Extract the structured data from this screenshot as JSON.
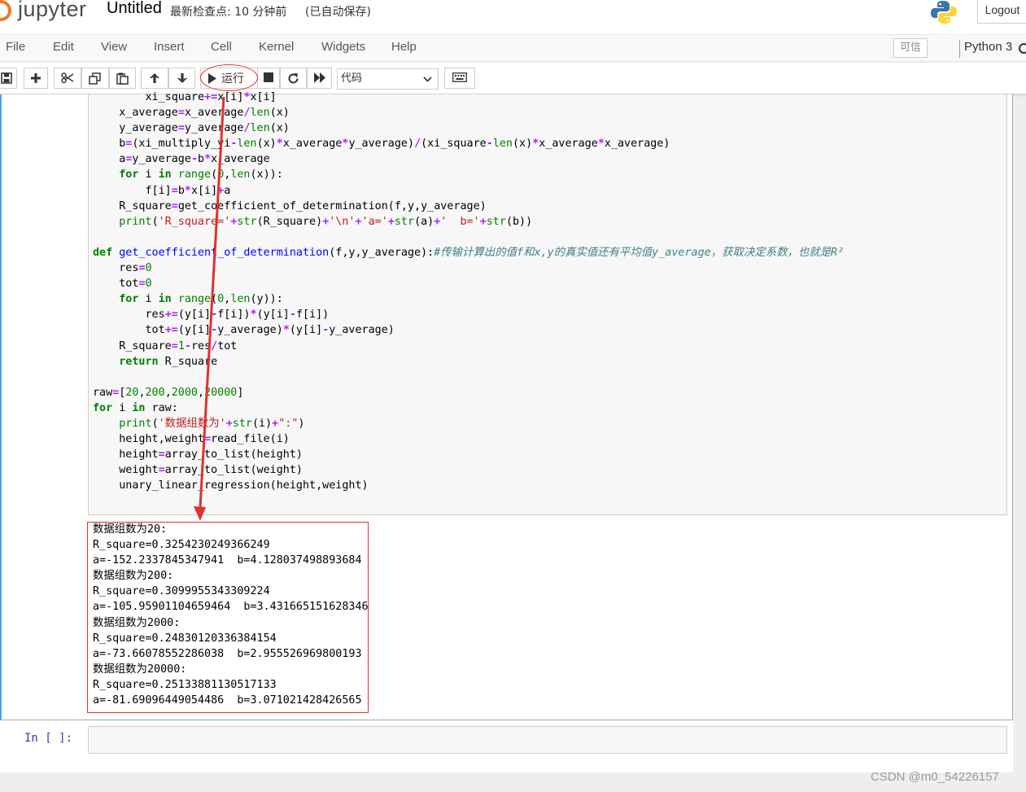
{
  "header": {
    "logo_text": "jupyter",
    "notebook_title": "Untitled",
    "checkpoint": "最新检查点: 10 分钟前",
    "autosave": "(已自动保存)",
    "logout_label": "Logout"
  },
  "menubar": {
    "items": [
      "File",
      "Edit",
      "View",
      "Insert",
      "Cell",
      "Kernel",
      "Widgets",
      "Help"
    ],
    "trusted_label": "可信",
    "kernel_name": "Python 3"
  },
  "toolbar": {
    "run_label": "运行",
    "cell_type": "代码"
  },
  "code_lines": [
    "        xi_square+=x[i]*x[i]",
    "    x_average=x_average/len(x)",
    "    y_average=y_average/len(x)",
    "    b=(xi_multiply_yi-len(x)*x_average*y_average)/(xi_square-len(x)*x_average*x_average)",
    "    a=y_average-b*x_average",
    "    for i in range(0,len(x)):",
    "        f[i]=b*x[i]+a",
    "    R_square=get_coefficient_of_determination(f,y,y_average)",
    "    print('R_square='+str(R_square)+'\\n'+'a='+str(a)+'  b='+str(b))",
    "",
    "def get_coefficient_of_determination(f,y,y_average):#传输计算出的值f和x,y的真实值还有平均值y_average，获取决定系数，也就是R²",
    "    res=0",
    "    tot=0",
    "    for i in range(0,len(y)):",
    "        res+=(y[i]-f[i])*(y[i]-f[i])",
    "        tot+=(y[i]-y_average)*(y[i]-y_average)",
    "    R_square=1-res/tot",
    "    return R_square",
    "",
    "raw=[20,200,2000,20000]",
    "for i in raw:",
    "    print('数据组数为'+str(i)+\":\")",
    "    height,weight=read_file(i)",
    "    height=array_to_list(height)",
    "    weight=array_to_list(weight)",
    "    unary_linear_regression(height,weight)"
  ],
  "output_lines": [
    "数据组数为20:",
    "R_square=0.3254230249366249",
    "a=-152.2337845347941  b=4.128037498893684",
    "数据组数为200:",
    "R_square=0.3099955343309224",
    "a=-105.95901104659464  b=3.431665151628346",
    "数据组数为2000:",
    "R_square=0.24830120336384154",
    "a=-73.66078552286038  b=2.955526969800193",
    "数据组数为20000:",
    "R_square=0.25133881130517133",
    "a=-81.69096449054486  b=3.071021428426565"
  ],
  "next_cell": {
    "prompt": "In  [  ]:"
  },
  "watermark": "CSDN @m0_54226157",
  "colors": {
    "accent_orange": "#f37726",
    "annotation_red": "#e0312f",
    "selected_cell_border": "#42a5f5"
  },
  "icons": [
    "save-icon",
    "plus-icon",
    "cut-icon",
    "copy-icon",
    "paste-icon",
    "arrow-up-icon",
    "arrow-down-icon",
    "play-icon",
    "stop-icon",
    "restart-icon",
    "fast-forward-icon",
    "keyboard-icon",
    "chevron-down-icon",
    "python-logo-icon"
  ]
}
